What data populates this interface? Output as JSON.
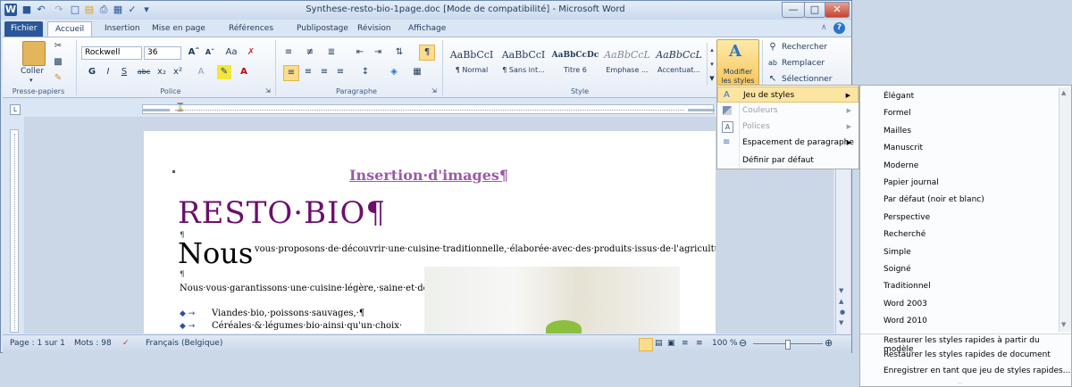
{
  "window": {
    "title": "Synthese-resto-bio-1page.doc [Mode de compatibilité] - Microsoft Word",
    "app_icon": "W",
    "controls": {
      "minimize": "—",
      "maximize": "□",
      "close": "✕"
    }
  },
  "tabs": [
    "Fichier",
    "Accueil",
    "Insertion",
    "Mise en page",
    "Références",
    "Publipostage",
    "Révision",
    "Affichage"
  ],
  "ribbon": {
    "clipboard": {
      "paste_label": "Coller",
      "group": "Presse-papiers"
    },
    "font": {
      "name": "Rockwell",
      "size": "36",
      "group": "Police"
    },
    "paragraph": {
      "group": "Paragraphe"
    },
    "styles": {
      "group": "Style",
      "gallery": [
        {
          "sample": "AaBbCcI",
          "name": "¶ Normal"
        },
        {
          "sample": "AaBbCcI",
          "name": "¶ Sans int..."
        },
        {
          "sample": "AaBbCcDc",
          "name": "Titre 6"
        },
        {
          "sample": "AaBbCcL",
          "name": "Emphase ..."
        },
        {
          "sample": "AaBbCcL",
          "name": "Accentuat..."
        }
      ],
      "change_styles": "Modifier les styles"
    },
    "editing": {
      "find": "Rechercher",
      "replace": "Remplacer",
      "select": "Sélectionner"
    }
  },
  "document": {
    "heading_link": "Insertion·d'images¶",
    "title": "RESTO·BIO¶",
    "dropcap": "Nous",
    "intro": "vous·proposons·de·découvrir·une·cuisine·traditionnelle,·élaborée·avec·des·produits·issus·de·l'agriculture·biologique.¶",
    "pilcrow": "¶",
    "para1": "Nous·vous·garantissons·une·cuisine·légère,·saine·et·de·qualité·comportant·:¶",
    "bullets": [
      "Viandes·bio,·poissons·sauvages,·¶",
      "Céréales·&·légumes·bio·ainsi·qu'un·choix·"
    ]
  },
  "status": {
    "page": "Page : 1 sur 1",
    "words": "Mots : 98",
    "language": "Français (Belgique)",
    "zoom": "100 %"
  },
  "menu": {
    "items": [
      {
        "label": "Jeu de styles",
        "arrow": true,
        "enabled": true,
        "active": true
      },
      {
        "label": "Couleurs",
        "arrow": true,
        "enabled": false
      },
      {
        "label": "Polices",
        "arrow": true,
        "enabled": false
      },
      {
        "label": "Espacement de paragraphe",
        "arrow": true,
        "enabled": true
      },
      {
        "label": "Définir par défaut",
        "arrow": false,
        "enabled": true
      }
    ]
  },
  "submenu": {
    "items": [
      "Élégant",
      "Formel",
      "Mailles",
      "Manuscrit",
      "Moderne",
      "Papier journal",
      "Par défaut (noir et blanc)",
      "Perspective",
      "Recherché",
      "Simple",
      "Soigné",
      "Traditionnel",
      "Word 2003",
      "Word 2010"
    ],
    "actions": [
      "Restaurer les styles rapides à partir du modèle",
      "Restaurer les styles rapides de document",
      "Enregistrer en tant que jeu de styles rapides..."
    ]
  },
  "colors": {
    "accent": "#2b579a",
    "title": "#6b0f6b",
    "link": "#9b5aa8",
    "highlight": "#fbdc8c"
  }
}
